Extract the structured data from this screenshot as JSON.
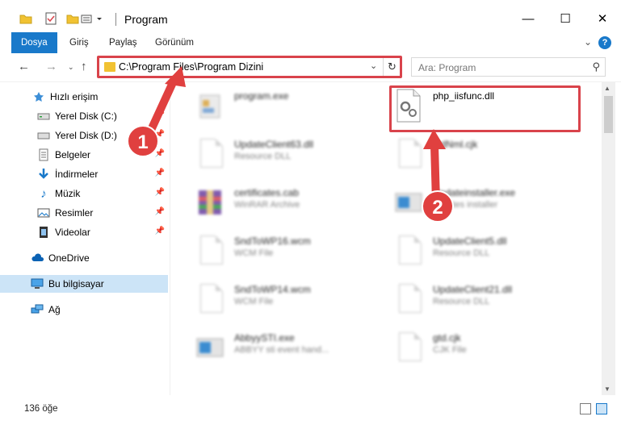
{
  "window": {
    "title": "Program",
    "minimize": "—",
    "maximize": "☐",
    "close": "✕"
  },
  "ribbon": {
    "tabs": [
      "Dosya",
      "Giriş",
      "Paylaş",
      "Görünüm"
    ],
    "help": "?"
  },
  "address": {
    "path": "C:\\Program Files\\Program Dizini",
    "search_placeholder": "Ara: Program"
  },
  "navpane": {
    "quick_access": "Hızlı erişim",
    "items": [
      {
        "label": "Yerel Disk (C:)",
        "icon": "drive-icon",
        "pinned": true
      },
      {
        "label": "Yerel Disk (D:)",
        "icon": "drive-icon",
        "pinned": true
      },
      {
        "label": "Belgeler",
        "icon": "documents-icon",
        "pinned": true
      },
      {
        "label": "İndirmeler",
        "icon": "download-icon",
        "pinned": true
      },
      {
        "label": "Müzik",
        "icon": "music-icon",
        "pinned": true
      },
      {
        "label": "Resimler",
        "icon": "pictures-icon",
        "pinned": true
      },
      {
        "label": "Videolar",
        "icon": "video-icon",
        "pinned": true
      }
    ],
    "onedrive": "OneDrive",
    "this_pc": "Bu bilgisayar",
    "network": "Ağ"
  },
  "files": [
    {
      "name": "program.exe",
      "type": "",
      "icon": "exe-icon",
      "blurred": true
    },
    {
      "name": "php_iisfunc.dll",
      "type": "",
      "icon": "dll-icon",
      "blurred": false
    },
    {
      "name": "UpdateClient63.dll",
      "type": "Resource DLL",
      "icon": "dll-icon",
      "blurred": true
    },
    {
      "name": "stdNml.cjk",
      "type": "",
      "icon": "file-icon",
      "blurred": true
    },
    {
      "name": "certificates.cab",
      "type": "WinRAR Archive",
      "icon": "archive-icon",
      "blurred": true
    },
    {
      "name": "Updateinstaller.exe",
      "type": "updates installer",
      "icon": "exe-icon",
      "blurred": true
    },
    {
      "name": "SndToWP16.wcm",
      "type": "WCM File",
      "icon": "file-icon",
      "blurred": true
    },
    {
      "name": "UpdateClient5.dll",
      "type": "Resource DLL",
      "icon": "dll-icon",
      "blurred": true
    },
    {
      "name": "SndToWP14.wcm",
      "type": "WCM File",
      "icon": "file-icon",
      "blurred": true
    },
    {
      "name": "UpdateClient21.dll",
      "type": "Resource DLL",
      "icon": "dll-icon",
      "blurred": true
    },
    {
      "name": "AbbyySTI.exe",
      "type": "ABBYY sti event hand...",
      "icon": "exe-icon",
      "blurred": true
    },
    {
      "name": "gtd.cjk",
      "type": "CJK File",
      "icon": "file-icon",
      "blurred": true
    }
  ],
  "status": {
    "count": "136 öğe"
  },
  "callouts": [
    "1",
    "2"
  ],
  "colors": {
    "accent": "#1979ca",
    "highlight": "#d9434b",
    "selected": "#cce4f7"
  }
}
